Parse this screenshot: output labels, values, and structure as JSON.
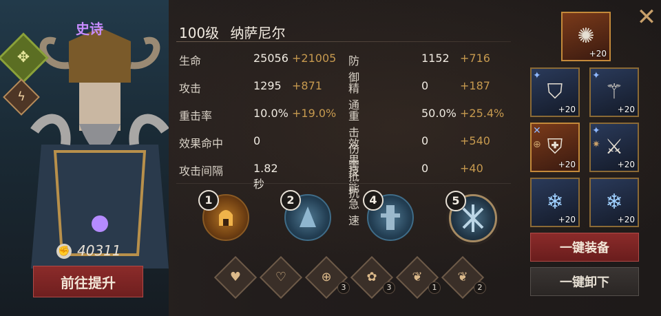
{
  "hero": {
    "rarity": "史诗",
    "power": "40311",
    "upgrade_button": "前往提升",
    "element_icon": "nature-leaf-icon",
    "class_icon": "lightning-icon"
  },
  "title": {
    "level": "100级",
    "name": "纳萨尼尔"
  },
  "stats": [
    {
      "label": "生命",
      "value": "25056",
      "bonus": "+21005",
      "label2": "防御",
      "value2": "1152",
      "bonus2": "+716"
    },
    {
      "label": "攻击",
      "value": "1295",
      "bonus": "+871",
      "label2": "精通",
      "value2": "0",
      "bonus2": "+187"
    },
    {
      "label": "重击率",
      "value": "10.0%",
      "bonus": "+19.0%",
      "label2": "重击伤害",
      "value2": "50.0%",
      "bonus2": "+25.4%"
    },
    {
      "label": "效果命中",
      "value": "0",
      "bonus": "",
      "label2": "效果抵抗",
      "value2": "0",
      "bonus2": "+540"
    },
    {
      "label": "攻击间隔",
      "value": "1.82秒",
      "bonus": "",
      "label2": "技能急速",
      "value2": "0",
      "bonus2": "+40"
    }
  ],
  "skills": [
    {
      "num": "1",
      "icon": "fire-helmet-icon"
    },
    {
      "num": "2",
      "icon": "ice-warrior-icon"
    },
    {
      "num": "4",
      "icon": "frost-knight-icon"
    },
    {
      "num": "5",
      "icon": "shatter-icon"
    }
  ],
  "talents": [
    {
      "icon": "heart-icon",
      "count": ""
    },
    {
      "icon": "heart-shield-icon",
      "count": ""
    },
    {
      "icon": "target-icon",
      "count": "3"
    },
    {
      "icon": "flower-icon",
      "count": "3"
    },
    {
      "icon": "leaf-plus-icon",
      "count": "1"
    },
    {
      "icon": "leaf-plus-icon",
      "count": "2"
    }
  ],
  "equipment": {
    "artifact": {
      "icon": "amulet-icon",
      "level": "+20"
    },
    "items": [
      {
        "icon": "hood-icon",
        "level": "+20"
      },
      {
        "icon": "staff-icon",
        "level": "+20"
      },
      {
        "icon": "chestplate-icon",
        "level": "+20"
      },
      {
        "icon": "bracer-icon",
        "level": "+20"
      },
      {
        "icon": "ice-crystal-icon",
        "level": "+20"
      },
      {
        "icon": "ice-crystal-icon",
        "level": "+20"
      }
    ]
  },
  "buttons": {
    "equip_all": "一键装备",
    "unequip_all": "一键卸下"
  },
  "colors": {
    "bonus": "#c79a4f",
    "rarity": "#c78cff",
    "primary_button": "#8b2b2a"
  }
}
